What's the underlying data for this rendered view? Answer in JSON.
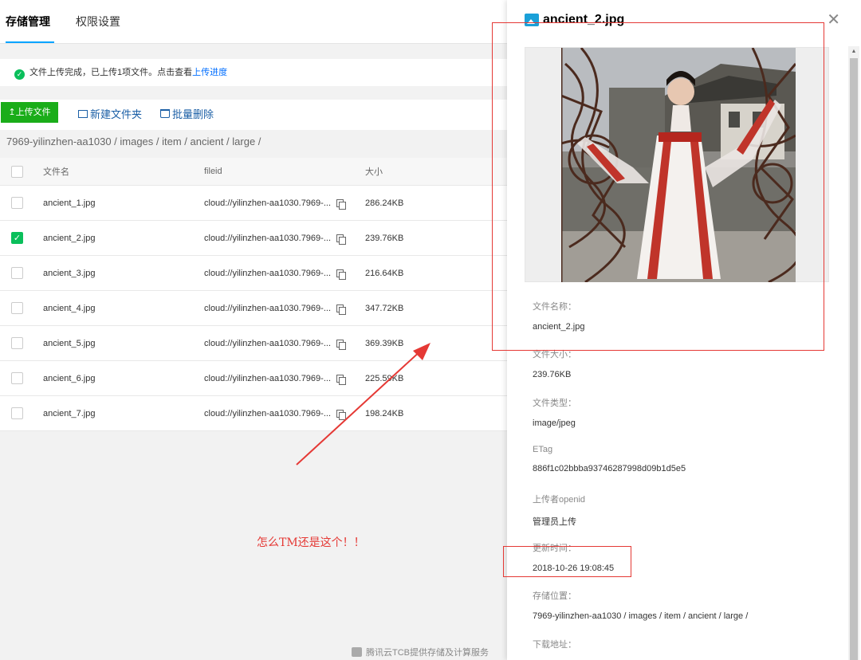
{
  "tabs": [
    {
      "label": "存储管理",
      "active": true
    },
    {
      "label": "权限设置",
      "active": false
    }
  ],
  "notice": {
    "text": "文件上传完成，已上传1项文件。点击查看",
    "link": "上传进度"
  },
  "toolbar": {
    "upload_label": "上传文件",
    "new_folder_label": "新建文件夹",
    "batch_delete_label": "批量删除"
  },
  "breadcrumb": "7969-yilinzhen-aa1030 / images / item / ancient / large /",
  "table": {
    "headers": {
      "name": "文件名",
      "fileid": "fileid",
      "size": "大小"
    },
    "rows": [
      {
        "name": "ancient_1.jpg",
        "fileid": "cloud://yilinzhen-aa1030.7969-...",
        "size": "286.24KB",
        "checked": false
      },
      {
        "name": "ancient_2.jpg",
        "fileid": "cloud://yilinzhen-aa1030.7969-...",
        "size": "239.76KB",
        "checked": true
      },
      {
        "name": "ancient_3.jpg",
        "fileid": "cloud://yilinzhen-aa1030.7969-...",
        "size": "216.64KB",
        "checked": false
      },
      {
        "name": "ancient_4.jpg",
        "fileid": "cloud://yilinzhen-aa1030.7969-...",
        "size": "347.72KB",
        "checked": false
      },
      {
        "name": "ancient_5.jpg",
        "fileid": "cloud://yilinzhen-aa1030.7969-...",
        "size": "369.39KB",
        "checked": false
      },
      {
        "name": "ancient_6.jpg",
        "fileid": "cloud://yilinzhen-aa1030.7969-...",
        "size": "225.59KB",
        "checked": false
      },
      {
        "name": "ancient_7.jpg",
        "fileid": "cloud://yilinzhen-aa1030.7969-...",
        "size": "198.24KB",
        "checked": false
      }
    ]
  },
  "footer_note": "腾讯云TCB提供存储及计算服务",
  "annotation": "怎么TM还是这个！！",
  "panel": {
    "title": "ancient_2.jpg",
    "fields": [
      {
        "key": "文件名称：",
        "value": "ancient_2.jpg"
      },
      {
        "key": "文件大小：",
        "value": "239.76KB"
      },
      {
        "key": "文件类型：",
        "value": "image/jpeg"
      },
      {
        "key": "ETag",
        "value": "886f1c02bbba93746287998d09b1d5e5"
      },
      {
        "key": "上传者openid",
        "value": "管理员上传"
      },
      {
        "key": "更新时间：",
        "value": "2018-10-26 19:08:45"
      },
      {
        "key": "存储位置：",
        "value": "7969-yilinzhen-aa1030 / images / item / ancient / large /"
      },
      {
        "key": "下载地址：",
        "value": ""
      }
    ]
  },
  "colors": {
    "accent_green": "#1aad19",
    "link_blue": "#006eff",
    "annotation_red": "#e53935"
  },
  "icons": [
    "check-circle-icon",
    "upload-icon",
    "folder-icon",
    "trash-icon",
    "copy-icon",
    "image-icon",
    "close-icon",
    "tcb-logo-icon"
  ]
}
